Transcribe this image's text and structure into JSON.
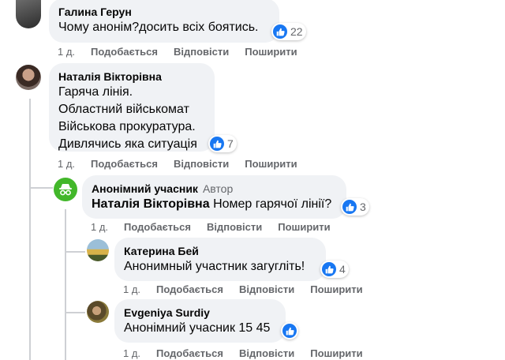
{
  "comments": [
    {
      "author": "Галина Герун",
      "text": "Чому анонім?досить всіх боятись.",
      "reactions": "22",
      "time": "1 д.",
      "like": "Подобається",
      "reply": "Відповісти",
      "share": "Поширити"
    },
    {
      "author": "Наталія Вікторівна",
      "text": "Гаряча лінія.\nОбластний військомат\nВійськова прокуратура.\nДивлячись яка ситуація",
      "reactions": "7",
      "time": "1 д.",
      "like": "Подобається",
      "reply": "Відповісти",
      "share": "Поширити"
    },
    {
      "author": "Анонімний учасник",
      "badge": "Автор",
      "mention": "Наталія Вікторівна",
      "text": "Номер гарячої лінії?",
      "reactions": "3",
      "time": "1 д.",
      "like": "Подобається",
      "reply": "Відповісти",
      "share": "Поширити"
    },
    {
      "author": "Катерина Бей",
      "text": "Анонимный участник загугліть!",
      "reactions": "4",
      "time": "1 д.",
      "like": "Подобається",
      "reply": "Відповісти",
      "share": "Поширити"
    },
    {
      "author": "Evgeniya Surdiy",
      "text": "Анонімний учасник 15 45",
      "time": "1 д.",
      "like": "Подобається",
      "reply": "Відповісти",
      "share": "Поширити"
    }
  ],
  "colors": {
    "accent": "#1877f2",
    "bubble": "#f0f2f5",
    "muted": "#65676b",
    "anon_green": "#42b72a"
  },
  "icons": [
    "avatar",
    "anonymous-icon",
    "like-icon"
  ]
}
